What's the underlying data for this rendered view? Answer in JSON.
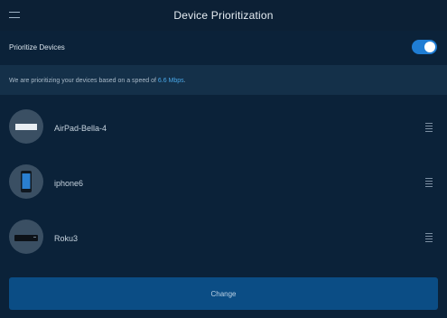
{
  "header": {
    "title": "Device Prioritization"
  },
  "prioritize": {
    "label": "Prioritize Devices",
    "enabled": true
  },
  "info": {
    "text_prefix": "We are prioritizing your devices based on a speed of ",
    "speed": "6.6 Mbps",
    "text_suffix": "."
  },
  "devices": [
    {
      "name": "AirPad-Bella-4",
      "icon": "laptop-icon"
    },
    {
      "name": "iphone6",
      "icon": "phone-icon"
    },
    {
      "name": "Roku3",
      "icon": "tv-box-icon"
    }
  ],
  "actions": {
    "change_label": "Change"
  },
  "colors": {
    "background": "#0b2239",
    "accent": "#1f7dd4",
    "button": "#0b4d85"
  }
}
